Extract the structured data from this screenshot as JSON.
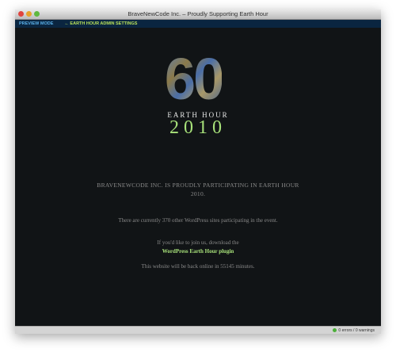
{
  "window": {
    "title": "BraveNewCode Inc. – Proudly Supporting Earth Hour"
  },
  "nav": {
    "preview": "PREVIEW MODE",
    "admin": "← EARTH HOUR ADMIN SETTINGS"
  },
  "logo": {
    "number": "60",
    "label": "EARTH HOUR",
    "year": "2010"
  },
  "content": {
    "headline": "BRAVENEWCODE INC. IS PROUDLY PARTICIPATING IN EARTH HOUR 2010.",
    "count_text": "There are currently 370 other WordPress sites participating in the event.",
    "join_text": "If you'd like to join us, download the",
    "plugin_link": "WordPress Earth Hour plugin",
    "back_text": "This website will be back online in 55145 minutes."
  },
  "status": {
    "text": "0 errors / 0 warnings"
  },
  "colors": {
    "accent": "#a8e27a",
    "nav_bg": "#0a2540",
    "preview": "#5ab0e8"
  }
}
